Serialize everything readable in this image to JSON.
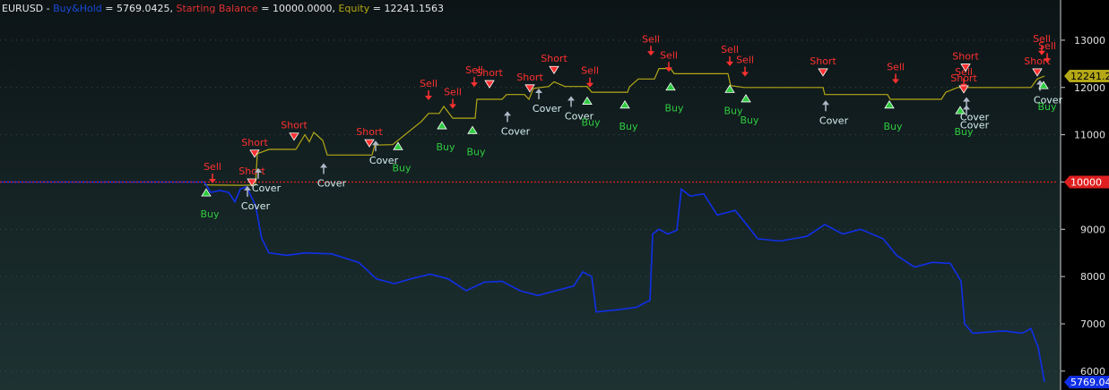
{
  "header": {
    "symbol": "EURUSD",
    "sep1": " - ",
    "bh_label": "Buy&Hold",
    "bh_eq": " = ",
    "bh_value": "5769.0425",
    "sep2": ", ",
    "sb_label": "Starting Balance",
    "sb_eq": " = ",
    "sb_value": "10000.0000",
    "sep3": ", ",
    "eq_label": "Equity",
    "eq_eq": " = ",
    "eq_value": "12241.1563"
  },
  "colors": {
    "background": "#0f1a1c",
    "axis_bg": "#000000",
    "equity": "#b4a817",
    "buy_hold": "#1030e8",
    "starting_balance": "#e02020",
    "sell_marker": "#ff3030",
    "buy_marker": "#2ecc40",
    "cover_marker": "#b0b8c8",
    "grid": "#3a4a4a"
  },
  "chart_data": {
    "type": "line",
    "y_ticks": [
      6000,
      7000,
      8000,
      9000,
      10000,
      11000,
      12000,
      13000
    ],
    "ylim": [
      5600,
      13850
    ],
    "x_range": [
      0,
      1180
    ],
    "grid": true,
    "value_labels": [
      {
        "text": "12241.2",
        "value": 12241.16,
        "series": "Equity"
      },
      {
        "text": "10000",
        "value": 10000,
        "series": "Starting Balance"
      },
      {
        "text": "5769.04",
        "value": 5769.04,
        "series": "Buy&Hold"
      }
    ],
    "series": [
      {
        "name": "Equity",
        "points": [
          [
            228,
            9940
          ],
          [
            240,
            9935
          ],
          [
            270,
            9932
          ],
          [
            285,
            9935
          ],
          [
            287,
            10600
          ],
          [
            300,
            10690
          ],
          [
            330,
            10690
          ],
          [
            340,
            11000
          ],
          [
            345,
            10850
          ],
          [
            350,
            11050
          ],
          [
            360,
            10880
          ],
          [
            365,
            10570
          ],
          [
            400,
            10570
          ],
          [
            415,
            10570
          ],
          [
            418,
            10780
          ],
          [
            438,
            10790
          ],
          [
            470,
            11280
          ],
          [
            478,
            11450
          ],
          [
            490,
            11450
          ],
          [
            495,
            11600
          ],
          [
            505,
            11350
          ],
          [
            530,
            11350
          ],
          [
            532,
            11750
          ],
          [
            560,
            11750
          ],
          [
            565,
            11850
          ],
          [
            585,
            11850
          ],
          [
            590,
            11750
          ],
          [
            595,
            11980
          ],
          [
            612,
            12020
          ],
          [
            618,
            12120
          ],
          [
            630,
            12020
          ],
          [
            655,
            12020
          ],
          [
            660,
            11900
          ],
          [
            700,
            11900
          ],
          [
            702,
            12010
          ],
          [
            712,
            12180
          ],
          [
            730,
            12180
          ],
          [
            735,
            12400
          ],
          [
            748,
            12400
          ],
          [
            752,
            12290
          ],
          [
            812,
            12290
          ],
          [
            815,
            12040
          ],
          [
            830,
            12000
          ],
          [
            918,
            12000
          ],
          [
            920,
            11850
          ],
          [
            990,
            11850
          ],
          [
            993,
            11750
          ],
          [
            1050,
            11750
          ],
          [
            1055,
            11900
          ],
          [
            1068,
            12000
          ],
          [
            1150,
            12000
          ],
          [
            1157,
            12180
          ],
          [
            1165,
            12241
          ]
        ]
      },
      {
        "name": "Buy&Hold",
        "points": [
          [
            0,
            10000
          ],
          [
            228,
            10000
          ],
          [
            235,
            9780
          ],
          [
            245,
            9820
          ],
          [
            255,
            9780
          ],
          [
            262,
            9580
          ],
          [
            268,
            9850
          ],
          [
            275,
            9900
          ],
          [
            280,
            9700
          ],
          [
            285,
            9500
          ],
          [
            292,
            8800
          ],
          [
            300,
            8500
          ],
          [
            320,
            8450
          ],
          [
            340,
            8500
          ],
          [
            370,
            8480
          ],
          [
            400,
            8300
          ],
          [
            420,
            7950
          ],
          [
            440,
            7850
          ],
          [
            460,
            7960
          ],
          [
            480,
            8050
          ],
          [
            500,
            7950
          ],
          [
            520,
            7700
          ],
          [
            540,
            7880
          ],
          [
            560,
            7900
          ],
          [
            580,
            7700
          ],
          [
            600,
            7600
          ],
          [
            620,
            7700
          ],
          [
            640,
            7800
          ],
          [
            650,
            8100
          ],
          [
            660,
            8000
          ],
          [
            665,
            7250
          ],
          [
            690,
            7300
          ],
          [
            710,
            7350
          ],
          [
            725,
            7500
          ],
          [
            728,
            8900
          ],
          [
            735,
            9000
          ],
          [
            745,
            8900
          ],
          [
            755,
            8980
          ],
          [
            760,
            9850
          ],
          [
            770,
            9700
          ],
          [
            785,
            9750
          ],
          [
            800,
            9300
          ],
          [
            820,
            9400
          ],
          [
            835,
            9050
          ],
          [
            845,
            8800
          ],
          [
            870,
            8750
          ],
          [
            900,
            8850
          ],
          [
            920,
            9100
          ],
          [
            940,
            8900
          ],
          [
            960,
            9000
          ],
          [
            985,
            8800
          ],
          [
            1000,
            8450
          ],
          [
            1020,
            8200
          ],
          [
            1040,
            8300
          ],
          [
            1060,
            8280
          ],
          [
            1072,
            7900
          ],
          [
            1076,
            7000
          ],
          [
            1085,
            6800
          ],
          [
            1120,
            6850
          ],
          [
            1140,
            6800
          ],
          [
            1150,
            6900
          ],
          [
            1158,
            6500
          ],
          [
            1165,
            5769
          ]
        ]
      },
      {
        "name": "Starting Balance",
        "points": [
          [
            0,
            10000
          ],
          [
            1180,
            10000
          ]
        ]
      }
    ],
    "signals": [
      {
        "type": "sell",
        "label": "Sell",
        "x": 237,
        "y": 9990
      },
      {
        "type": "buy",
        "label": "Buy",
        "x": 230,
        "y": 9780
      },
      {
        "type": "short",
        "label": "Short",
        "x": 284,
        "y": 10600
      },
      {
        "type": "short",
        "label": "Short",
        "x": 281,
        "y": 9990
      },
      {
        "type": "cover",
        "label": "Cover",
        "x": 288,
        "y": 10220
      },
      {
        "type": "cover",
        "label": "Cover",
        "x": 276,
        "y": 9840
      },
      {
        "type": "short",
        "label": "Short",
        "x": 328,
        "y": 10960
      },
      {
        "type": "cover",
        "label": "Cover",
        "x": 361,
        "y": 10320
      },
      {
        "type": "short",
        "label": "Short",
        "x": 412,
        "y": 10820
      },
      {
        "type": "cover",
        "label": "Cover",
        "x": 419,
        "y": 10800
      },
      {
        "type": "buy",
        "label": "Buy",
        "x": 444,
        "y": 10760
      },
      {
        "type": "sell",
        "label": "Sell",
        "x": 478,
        "y": 11750
      },
      {
        "type": "buy",
        "label": "Buy",
        "x": 493,
        "y": 11200
      },
      {
        "type": "sell",
        "label": "Sell",
        "x": 505,
        "y": 11570
      },
      {
        "type": "buy",
        "label": "Buy",
        "x": 527,
        "y": 11100
      },
      {
        "type": "sell",
        "label": "Sell",
        "x": 529,
        "y": 12030
      },
      {
        "type": "short",
        "label": "Short",
        "x": 546,
        "y": 12070
      },
      {
        "type": "cover",
        "label": "Cover",
        "x": 566,
        "y": 11420
      },
      {
        "type": "short",
        "label": "Short",
        "x": 591,
        "y": 11980
      },
      {
        "type": "cover",
        "label": "Cover",
        "x": 601,
        "y": 11900
      },
      {
        "type": "short",
        "label": "Short",
        "x": 618,
        "y": 12370
      },
      {
        "type": "cover",
        "label": "Cover",
        "x": 637,
        "y": 11740
      },
      {
        "type": "buy",
        "label": "Buy",
        "x": 655,
        "y": 11720
      },
      {
        "type": "sell",
        "label": "Sell",
        "x": 658,
        "y": 12020
      },
      {
        "type": "buy",
        "label": "Buy",
        "x": 697,
        "y": 11640
      },
      {
        "type": "sell",
        "label": "Sell",
        "x": 726,
        "y": 12690
      },
      {
        "type": "sell",
        "label": "Sell",
        "x": 746,
        "y": 12350
      },
      {
        "type": "buy",
        "label": "Buy",
        "x": 748,
        "y": 12020
      },
      {
        "type": "sell",
        "label": "Sell",
        "x": 814,
        "y": 12470
      },
      {
        "type": "sell",
        "label": "Sell",
        "x": 831,
        "y": 12250
      },
      {
        "type": "buy",
        "label": "Buy",
        "x": 814,
        "y": 11970
      },
      {
        "type": "buy",
        "label": "Buy",
        "x": 832,
        "y": 11770
      },
      {
        "type": "short",
        "label": "Short",
        "x": 918,
        "y": 12320
      },
      {
        "type": "cover",
        "label": "Cover",
        "x": 921,
        "y": 11650
      },
      {
        "type": "sell",
        "label": "Sell",
        "x": 999,
        "y": 12100
      },
      {
        "type": "buy",
        "label": "Buy",
        "x": 992,
        "y": 11640
      },
      {
        "type": "sell",
        "label": "Sell",
        "x": 1075,
        "y": 12000
      },
      {
        "type": "short",
        "label": "Short",
        "x": 1077,
        "y": 12420
      },
      {
        "type": "short",
        "label": "Short",
        "x": 1075,
        "y": 11960
      },
      {
        "type": "cover",
        "label": "Cover",
        "x": 1078,
        "y": 11720
      },
      {
        "type": "cover",
        "label": "Cover",
        "x": 1078,
        "y": 11550
      },
      {
        "type": "buy",
        "label": "Buy",
        "x": 1071,
        "y": 11520
      },
      {
        "type": "sell",
        "label": "Sell",
        "x": 1162,
        "y": 12700
      },
      {
        "type": "sell",
        "label": "Sell",
        "x": 1168,
        "y": 12540
      },
      {
        "type": "short",
        "label": "Short",
        "x": 1157,
        "y": 12320
      },
      {
        "type": "cover",
        "label": "Cover",
        "x": 1160,
        "y": 12080
      },
      {
        "type": "buy",
        "label": "Buy",
        "x": 1164,
        "y": 12050
      }
    ]
  }
}
